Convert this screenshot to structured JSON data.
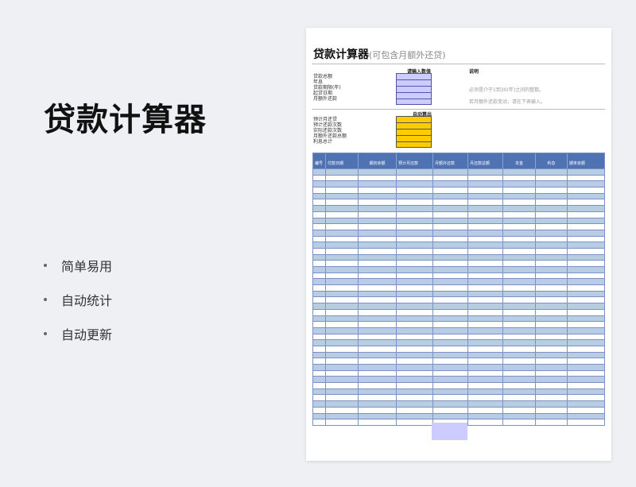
{
  "slide": {
    "title": "贷款计算器",
    "bullets": [
      "简单易用",
      "自动统计",
      "自动更新"
    ]
  },
  "sheet": {
    "title": "贷款计算器",
    "subtitle": "(可包含月额外还贷)",
    "input_header": "请输入数值",
    "note_header": "说明",
    "input_labels": [
      "贷款总额",
      "年息",
      "贷款期限(年)",
      "起贷日期",
      "月额外还款"
    ],
    "notes": [
      "必须是介于1到30(年)之间的整数。",
      "若月额外还款变动，请在下表输入。"
    ],
    "output_header": "自动算出",
    "output_labels": [
      "预计月还贷",
      "预计还款次数",
      "实际还款次数",
      "月额外还款总额",
      "利息总计"
    ],
    "table_headers": [
      "编号",
      "付款日期",
      "期初余额",
      "预计月还款",
      "月额外还款",
      "月还款总额",
      "本金",
      "利息",
      "期末余额"
    ]
  }
}
